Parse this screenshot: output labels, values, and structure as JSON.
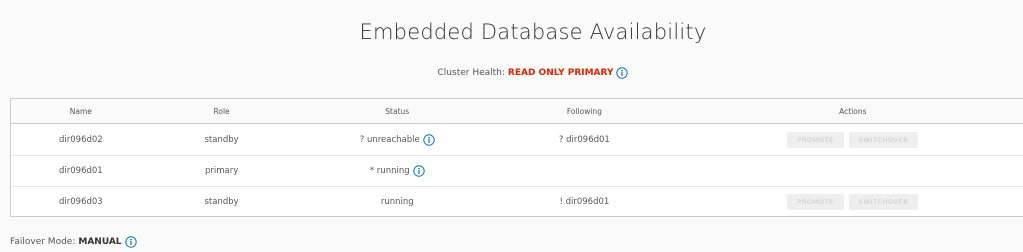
{
  "page": {
    "title": "Embedded Database Availability"
  },
  "cluster_health": {
    "label": "Cluster Health:",
    "value": "READ ONLY PRIMARY",
    "icon": "info-icon"
  },
  "table": {
    "columns": [
      "Name",
      "Role",
      "Status",
      "Following",
      "Actions"
    ],
    "rows": [
      {
        "name": "dir096d02",
        "role": "standby",
        "status": "? unreachable",
        "status_info": true,
        "following": "? dir096d01",
        "actions": [
          "PROMOTE",
          "SWITCHOVER"
        ]
      },
      {
        "name": "dir096d01",
        "role": "primary",
        "status": "* running",
        "status_info": true,
        "following": "",
        "actions": []
      },
      {
        "name": "dir096d03",
        "role": "standby",
        "status": "running",
        "status_info": false,
        "following": "! dir096d01",
        "actions": [
          "PROMOTE",
          "SWITCHOVER"
        ]
      }
    ]
  },
  "failover": {
    "label": "Failover Mode:",
    "value": "MANUAL",
    "icon": "info-icon"
  },
  "colors": {
    "health_value": "#e12200",
    "info_icon": "#0079b8",
    "button_disabled_bg": "#eeeeee",
    "button_disabled_text": "#c8c8c8"
  }
}
